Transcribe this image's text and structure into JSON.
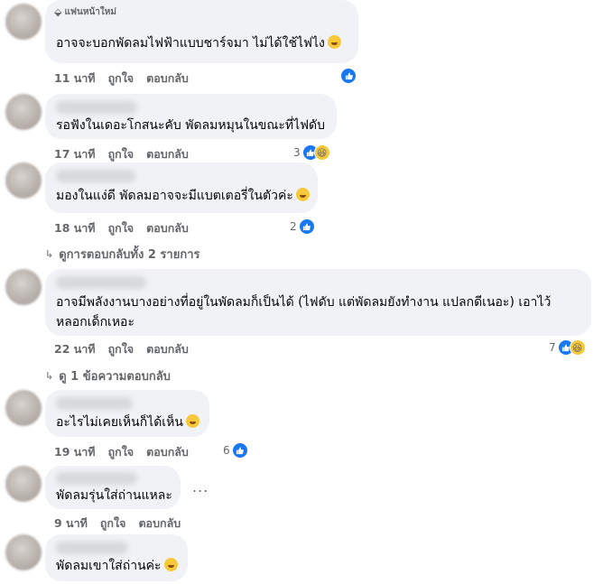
{
  "badge": {
    "label": "แฟนหน้าใหม่",
    "icon": "diamond-icon"
  },
  "comments": [
    {
      "text": "อาจจะบอกพัดลมไฟฟ้าแบบชาร์จมา ไม่ได้ใช้ไฟไง",
      "time": "11 นาที",
      "like": "ถูกใจ",
      "reply": "ตอบกลับ",
      "reactions": ""
    },
    {
      "text": "รอฟังในเดอะโกสนะคับ พัดลมหมุนในขณะที่ไฟดับ",
      "time": "17 นาที",
      "like": "ถูกใจ",
      "reply": "ตอบกลับ",
      "reactions": "3"
    },
    {
      "text": "มองในแง่ดี พัดลมอาจจะมีแบตเตอรี่ในตัวค่ะ",
      "time": "18 นาที",
      "like": "ถูกใจ",
      "reply": "ตอบกลับ",
      "reactions": "2"
    },
    {
      "text_line1": "อาจมีพลังงานบางอย่างที่อยู่ในพัดลมก็เป็นได้ (ไฟดับ แต่พัดลมยังทำงาน แปลกดีเนอะ) เอาไว้",
      "text_line2": "หลอกเด็กเหอะ",
      "time": "22 นาที",
      "like": "ถูกใจ",
      "reply": "ตอบกลับ",
      "reactions": "7"
    },
    {
      "text": "อะไรไม่เคยเห็นก็ได้เห็น",
      "time": "19 นาที",
      "like": "ถูกใจ",
      "reply": "ตอบกลับ",
      "reactions": "6"
    },
    {
      "text": "พัดลมรุ่นใส่ถ่านแหละ",
      "time": "9 นาที",
      "like": "ถูกใจ",
      "reply": "ตอบกลับ",
      "more": "..."
    },
    {
      "text": "พัดลมเขาใส่ถ่านค่ะ"
    }
  ],
  "view_replies_1": "ดูการตอบกลับทั้ง 2 รายการ",
  "view_replies_2": "ดู 1 ข้อความตอบกลับ"
}
